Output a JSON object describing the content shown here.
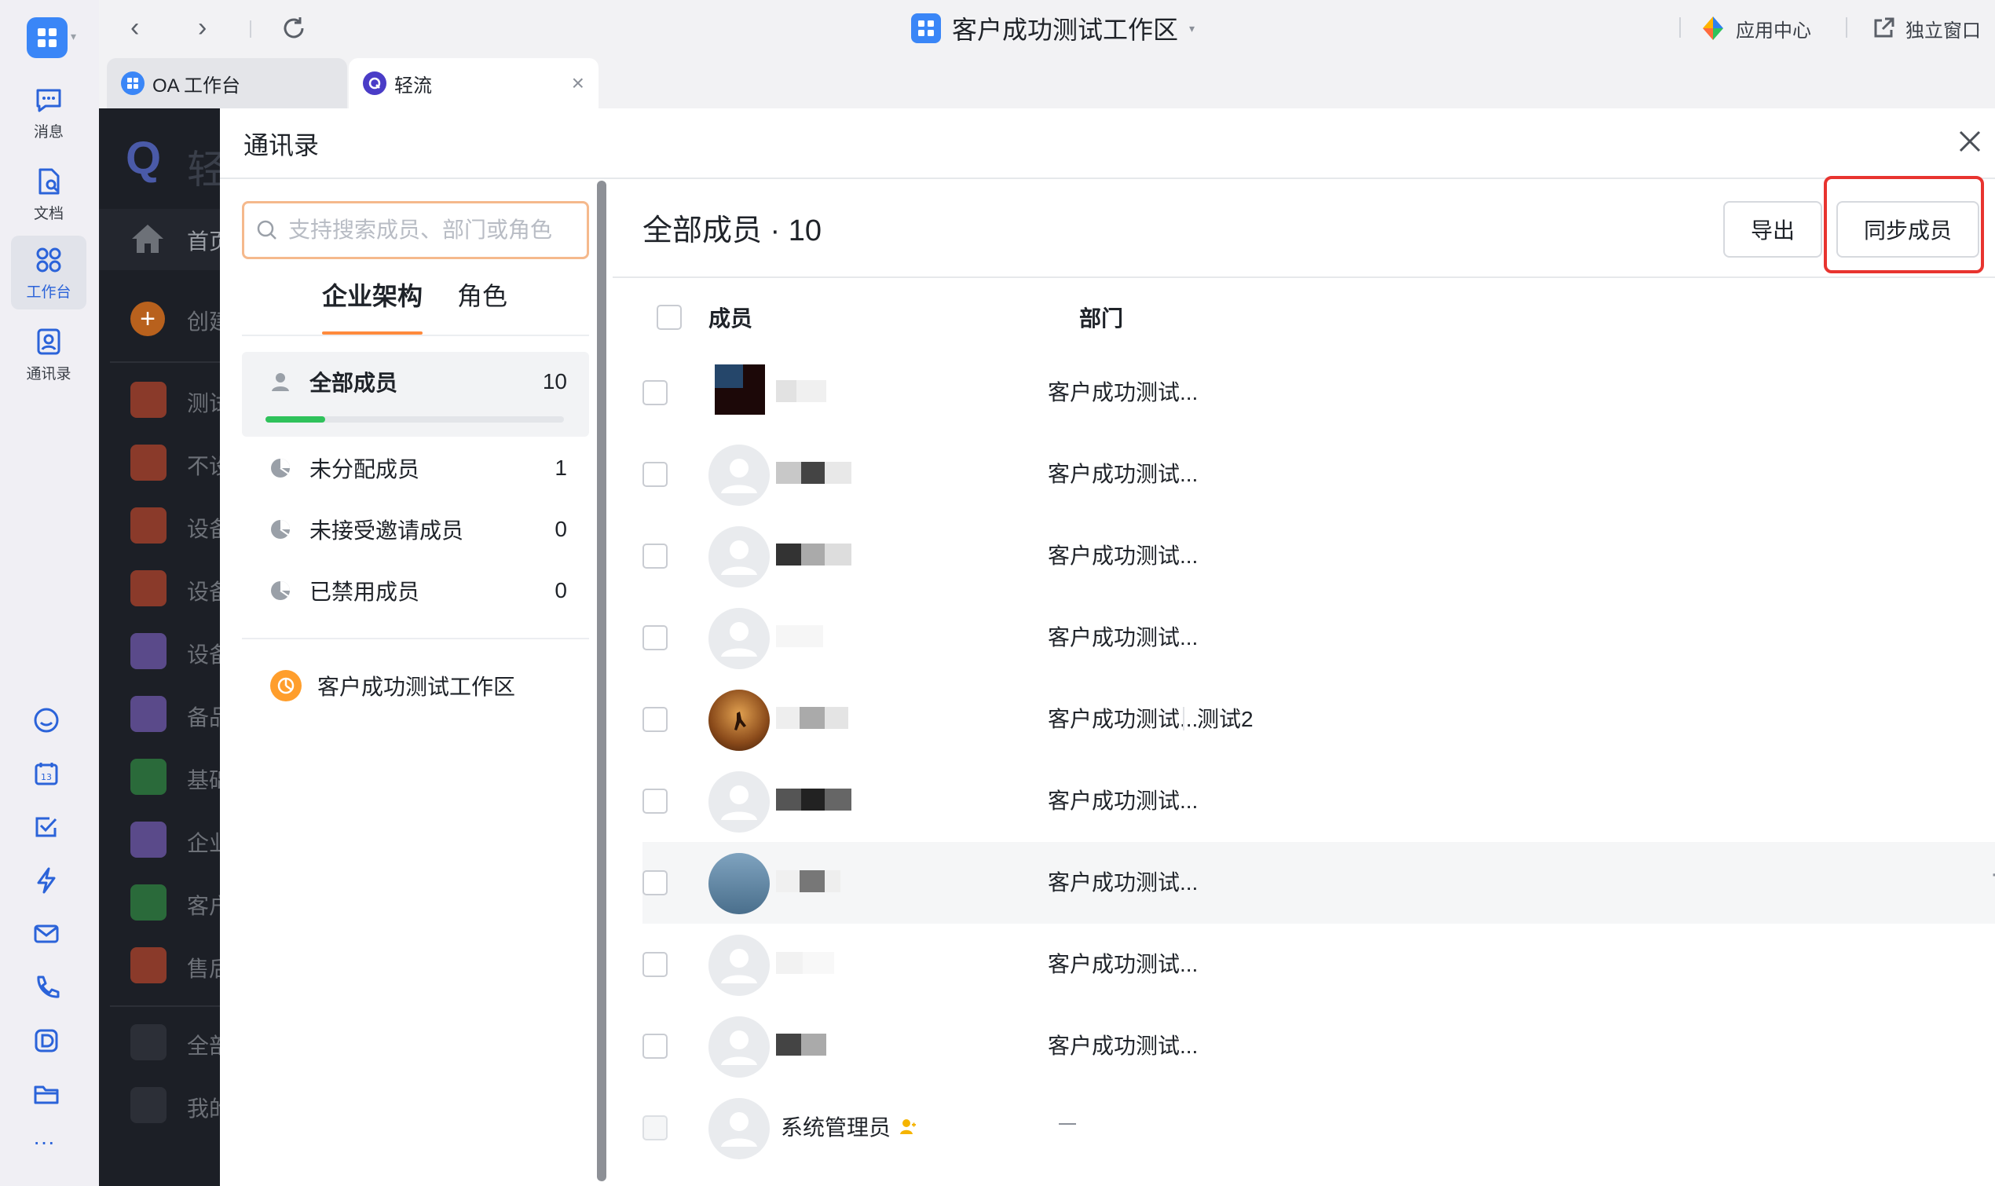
{
  "rail": {
    "items": [
      {
        "label": "消息",
        "icon": "message-icon"
      },
      {
        "label": "文档",
        "icon": "document-icon"
      },
      {
        "label": "工作台",
        "icon": "workbench-icon",
        "active": true
      },
      {
        "label": "通讯录",
        "icon": "contacts-icon"
      }
    ],
    "bottom_icons": [
      "cloud-icon",
      "calendar-icon",
      "todo-check-icon",
      "lightning-icon",
      "mail-icon",
      "phone-icon",
      "d-app-icon",
      "folder-icon"
    ],
    "more_label": "···"
  },
  "titlebar": {
    "workspace_title": "客户成功测试工作区",
    "app_center_label": "应用中心",
    "standalone_label": "独立窗口"
  },
  "tabs": [
    {
      "label": "OA 工作台",
      "active": false
    },
    {
      "label": "轻流",
      "active": true
    }
  ],
  "background_app": {
    "items": [
      "轻",
      "首页",
      "创建",
      "测试",
      "不设",
      "设备",
      "设备",
      "设备",
      "备品",
      "基础",
      "企业",
      "客户",
      "售后",
      "全部",
      "我的"
    ]
  },
  "modal": {
    "title": "通讯录",
    "search_placeholder": "支持搜索成员、部门或角色",
    "tabs": [
      "企业架构",
      "角色"
    ],
    "groups": [
      {
        "label": "全部成员",
        "count": "10",
        "progress": 0.2
      },
      {
        "label": "未分配成员",
        "count": "1"
      },
      {
        "label": "未接受邀请成员",
        "count": "0"
      },
      {
        "label": "已禁用成员",
        "count": "0"
      }
    ],
    "workspace": "客户成功测试工作区",
    "member_title": "全部成员 · 10",
    "export_label": "导出",
    "sync_label": "同步成员",
    "columns": {
      "member": "成员",
      "department": "部门"
    },
    "members": [
      {
        "dept": "客户成功测试..."
      },
      {
        "dept": "客户成功测试..."
      },
      {
        "dept": "客户成功测试..."
      },
      {
        "dept": "客户成功测试..."
      },
      {
        "dept": "客户成功测试...",
        "dept2": "测试2"
      },
      {
        "dept": "客户成功测试..."
      },
      {
        "dept": "客户成功测试...",
        "more": "···"
      },
      {
        "dept": "客户成功测试..."
      },
      {
        "dept": "客户成功测试..."
      },
      {
        "name": "系统管理员",
        "dept": ""
      }
    ]
  },
  "colors": {
    "accent_orange": "#ff8a3d",
    "highlight_red": "#e8342f",
    "progress_green": "#2fc25b",
    "brand_blue": "#3a86f7"
  }
}
